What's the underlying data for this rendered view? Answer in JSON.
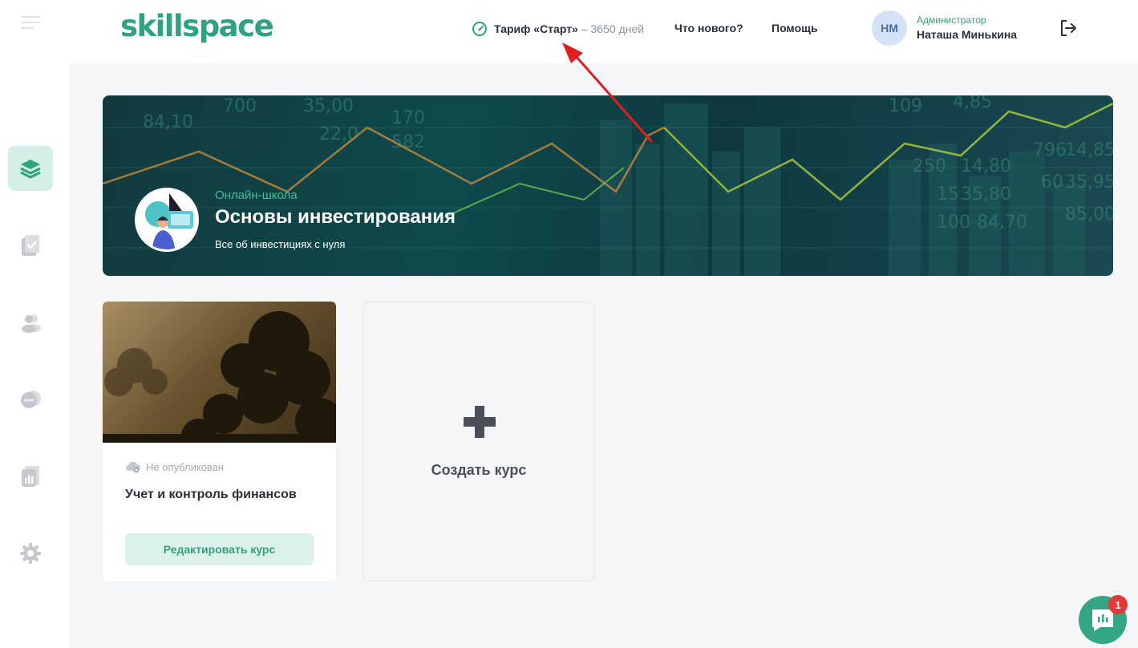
{
  "header": {
    "logo": "skillspace",
    "tariff_name": "Тариф «Старт»",
    "tariff_days": "– 3650 дней",
    "nav": [
      "Что нового?",
      "Помощь"
    ],
    "user": {
      "initials": "НМ",
      "role": "Администратор",
      "name": "Наташа Минькина"
    }
  },
  "sidebar": {
    "items": [
      {
        "icon": "layers-icon",
        "active": true
      },
      {
        "icon": "document-check-icon",
        "active": false
      },
      {
        "icon": "users-icon",
        "active": false
      },
      {
        "icon": "chat-icon",
        "active": false
      },
      {
        "icon": "stats-icon",
        "active": false
      },
      {
        "icon": "settings-icon",
        "active": false
      }
    ]
  },
  "banner": {
    "label": "Онлайн-школа",
    "title": "Основы инвестирования",
    "subtitle": "Все об инвестициях с нуля"
  },
  "courses": [
    {
      "status": "Не опубликован",
      "title": "Учет и контроль финансов",
      "edit_label": "Редактировать курс"
    }
  ],
  "create_card": {
    "label": "Создать курс"
  },
  "chat": {
    "badge_count": "1"
  },
  "colors": {
    "accent": "#2fa37f",
    "annotation_arrow": "#e02020"
  }
}
